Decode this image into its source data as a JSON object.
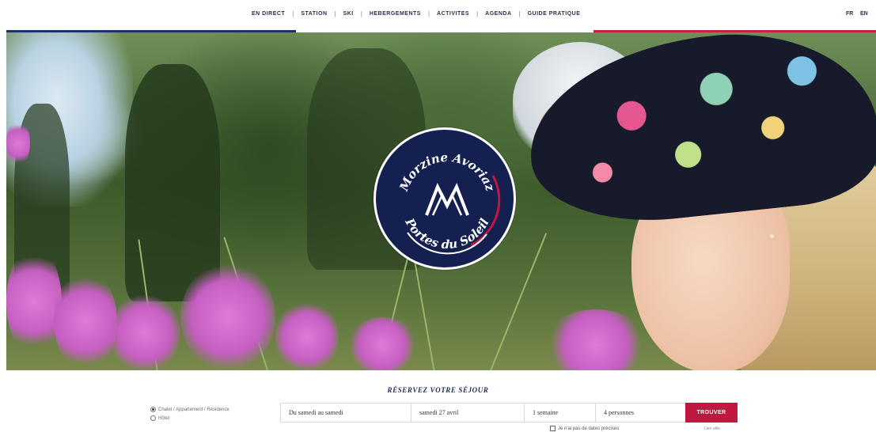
{
  "nav": {
    "items": [
      {
        "label": "EN DIRECT"
      },
      {
        "label": "STATION"
      },
      {
        "label": "SKI"
      },
      {
        "label": "HEBERGEMENTS"
      },
      {
        "label": "ACTIVITES"
      },
      {
        "label": "AGENDA"
      },
      {
        "label": "GUIDE PRATIQUE"
      }
    ],
    "separator": "|",
    "lang_fr": "FR",
    "lang_en": "EN"
  },
  "colors": {
    "brand_navy": "#142150",
    "accent_red": "#c0173f",
    "bar_blue": "#1e2f6b",
    "bar_red": "#c0224a"
  },
  "hero": {
    "logo": {
      "top_text": "Morzine Avoriaz",
      "bottom_text": "Portes du Soleil"
    }
  },
  "booking": {
    "title": "RÉSERVEZ VOTRE SÉJOUR",
    "radio_options": [
      {
        "label": "Chalet / Appartement / Résidence",
        "checked": true
      },
      {
        "label": "Hôtel",
        "checked": false
      }
    ],
    "fields": {
      "period": "Du samedi au samedi",
      "date": "samedi 27 avril",
      "duration": "1 semaine",
      "people": "4 personnes"
    },
    "button_label": "TROUVER",
    "flex_label": "Je n'ai pas de dates précises",
    "small_link": "Lien utile"
  }
}
